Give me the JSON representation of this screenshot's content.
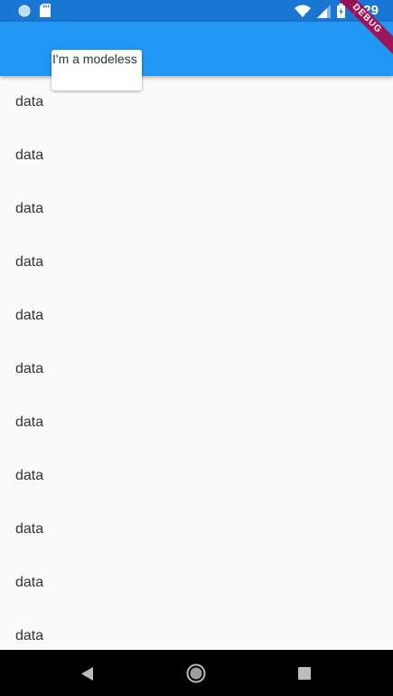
{
  "status_bar": {
    "time": "7:29",
    "icons": [
      "circle-icon",
      "sd-card-icon",
      "wifi-icon",
      "signal-icon",
      "battery-icon"
    ],
    "color": "#1976d2"
  },
  "app_bar": {
    "color": "#2196f3"
  },
  "debug_banner": {
    "label": "DEBUG"
  },
  "popup": {
    "text": "I'm a modeless"
  },
  "list": {
    "items": [
      {
        "label": "data"
      },
      {
        "label": "data"
      },
      {
        "label": "data"
      },
      {
        "label": "data"
      },
      {
        "label": "data"
      },
      {
        "label": "data"
      },
      {
        "label": "data"
      },
      {
        "label": "data"
      },
      {
        "label": "data"
      },
      {
        "label": "data"
      },
      {
        "label": "data"
      }
    ]
  },
  "nav_bar": {
    "icons": [
      "back-icon",
      "home-icon",
      "recents-icon"
    ]
  }
}
